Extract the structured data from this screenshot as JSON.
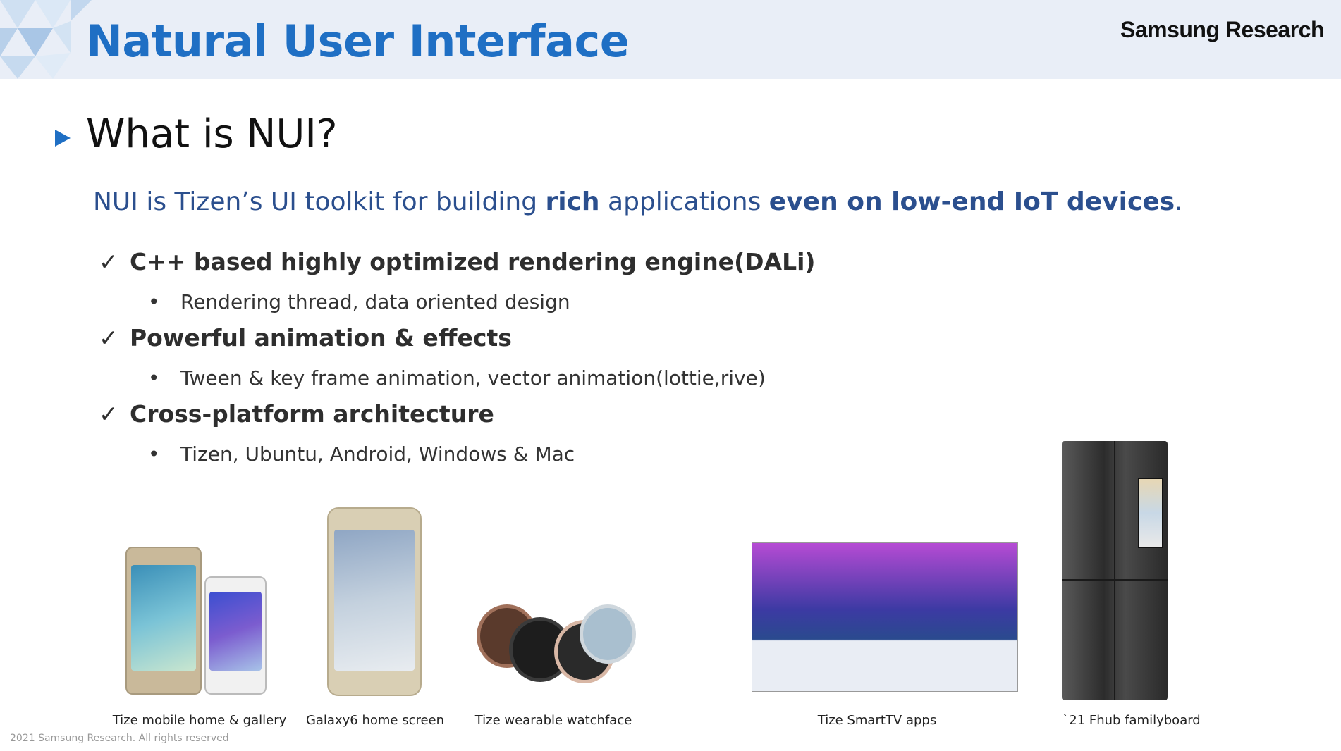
{
  "header": {
    "title": "Natural User Interface",
    "brand": "Samsung Research"
  },
  "section": {
    "title": "What is NUI?"
  },
  "lead": {
    "part1": "NUI is Tizen’s UI toolkit for building ",
    "bold1": "rich",
    "part2": " applications ",
    "bold2": "even on low-end IoT devices",
    "part3": "."
  },
  "features": [
    {
      "check": "✓",
      "title": "C++ based highly optimized rendering engine(DALi)",
      "bullet": "•",
      "detail": "Rendering thread, data oriented design"
    },
    {
      "check": "✓",
      "title": "Powerful animation & effects",
      "bullet": "•",
      "detail": "Tween & key frame animation, vector animation(lottie,rive)"
    },
    {
      "check": "✓",
      "title": "Cross-platform architecture",
      "bullet": "•",
      "detail": "Tizen, Ubuntu, Android, Windows & Mac"
    }
  ],
  "devices": [
    {
      "caption": "Tize mobile home & gallery"
    },
    {
      "caption": "Galaxy6 home screen"
    },
    {
      "caption": "Tize wearable watchface"
    },
    {
      "caption": "Tize SmartTV apps"
    },
    {
      "caption": "`21 Fhub familyboard"
    }
  ],
  "footer": {
    "copyright": "2021 Samsung Research. All rights reserved"
  },
  "colors": {
    "accent": "#1f6fc4",
    "lead_text": "#2b4f8e",
    "header_bg": "#e9eef7"
  }
}
